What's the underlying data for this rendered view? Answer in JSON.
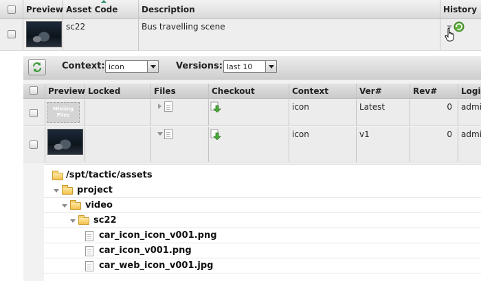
{
  "top_table": {
    "headers": {
      "preview": "Preview",
      "asset_code": "Asset Code",
      "description": "Description",
      "history": "History"
    },
    "row": {
      "asset_code": "sc22",
      "description": "Bus travelling scene"
    }
  },
  "panel": {
    "context_label": "Context:",
    "context_value": "icon",
    "versions_label": "Versions:",
    "versions_value": "last 10",
    "headers": {
      "preview": "Preview",
      "locked": "Locked",
      "files": "Files",
      "checkout": "Checkout",
      "context": "Context",
      "ver": "Ver#",
      "rev": "Rev#",
      "login": "Login"
    },
    "rows": [
      {
        "missing_line1": "Missing",
        "missing_line2": "Files",
        "context": "icon",
        "ver": "Latest",
        "rev": "0",
        "login": "admin"
      },
      {
        "context": "icon",
        "ver": "v1",
        "rev": "0",
        "login": "admin"
      }
    ]
  },
  "tree": {
    "root": "/spt/tactic/assets",
    "project": "project",
    "video": "video",
    "sc22": "sc22",
    "files": [
      "car_icon_icon_v001.png",
      "car_icon_v001.png",
      "car_web_icon_v001.jpg"
    ]
  },
  "icons": {
    "refresh": "refresh-icon",
    "history": "history-icon",
    "checkout": "checkout-arrow-icon",
    "file": "document-icon",
    "folder": "folder-icon"
  },
  "colors": {
    "accent_green": "#3a9a3a",
    "folder": "#f3c04a"
  }
}
